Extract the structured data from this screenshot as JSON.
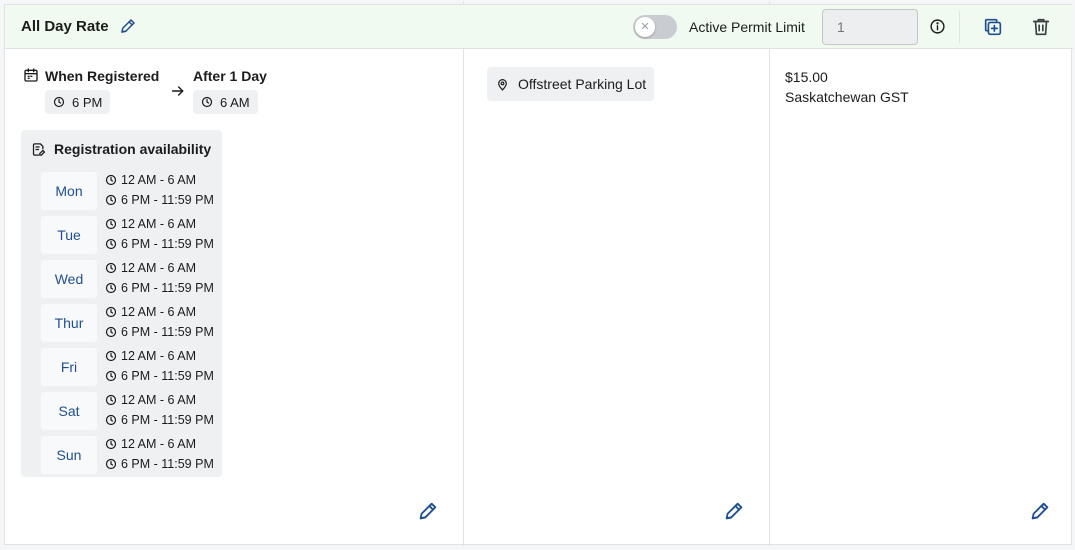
{
  "header": {
    "title": "All Day Rate",
    "permit_limit_label": "Active Permit Limit",
    "permit_limit_value": "",
    "permit_limit_placeholder": "1",
    "toggle_enabled": false
  },
  "schedule": {
    "start_label": "When Registered",
    "start_time": "6 PM",
    "end_label": "After 1 Day",
    "end_time": "6 AM"
  },
  "availability": {
    "title": "Registration availability",
    "days": [
      {
        "day": "Mon",
        "slots": [
          "12 AM - 6 AM",
          "6 PM - 11:59 PM"
        ]
      },
      {
        "day": "Tue",
        "slots": [
          "12 AM - 6 AM",
          "6 PM - 11:59 PM"
        ]
      },
      {
        "day": "Wed",
        "slots": [
          "12 AM - 6 AM",
          "6 PM - 11:59 PM"
        ]
      },
      {
        "day": "Thur",
        "slots": [
          "12 AM - 6 AM",
          "6 PM - 11:59 PM"
        ]
      },
      {
        "day": "Fri",
        "slots": [
          "12 AM - 6 AM",
          "6 PM - 11:59 PM"
        ]
      },
      {
        "day": "Sat",
        "slots": [
          "12 AM - 6 AM",
          "6 PM - 11:59 PM"
        ]
      },
      {
        "day": "Sun",
        "slots": [
          "12 AM - 6 AM",
          "6 PM - 11:59 PM"
        ]
      }
    ]
  },
  "location": {
    "name": "Offstreet Parking Lot"
  },
  "pricing": {
    "price": "$15.00",
    "tax": "Saskatchewan GST"
  },
  "colors": {
    "accent": "#1f4f8f",
    "header_bg": "#f0faf0",
    "chip_bg": "#eef0f2"
  },
  "icons": {
    "edit": "pencil-icon",
    "duplicate": "duplicate-icon",
    "delete": "trash-icon",
    "info": "info-icon",
    "calendar": "calendar-icon",
    "clock": "clock-icon",
    "location": "location-pin-icon",
    "availability": "edit-document-icon"
  }
}
